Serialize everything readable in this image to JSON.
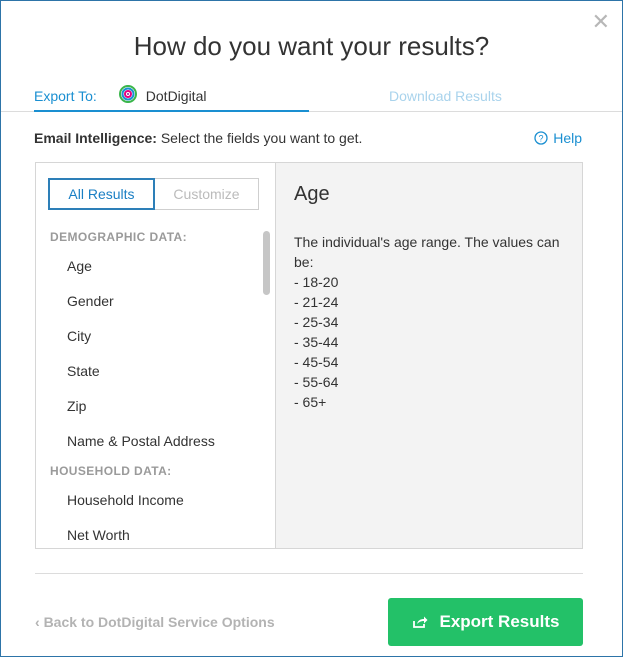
{
  "dialog": {
    "title": "How do you want your results?",
    "close_icon": "close-icon"
  },
  "tabs": {
    "export_label": "Export To:",
    "service_name": "DotDigital",
    "download_label": "Download Results"
  },
  "subheader": {
    "bold": "Email Intelligence:",
    "text": " Select the fields you want to get.",
    "help_label": "Help"
  },
  "segmented": {
    "all_results": "All Results",
    "customize": "Customize"
  },
  "fields": {
    "demographic_header": "DEMOGRAPHIC DATA:",
    "demographic_items": [
      "Age",
      "Gender",
      "City",
      "State",
      "Zip",
      "Name & Postal Address"
    ],
    "household_header": "HOUSEHOLD DATA:",
    "household_items": [
      "Household Income",
      "Net Worth"
    ]
  },
  "detail": {
    "title": "Age",
    "description": "The individual's age range. The values can be:",
    "values": [
      "- 18-20",
      "- 21-24",
      "- 25-34",
      "- 35-44",
      "- 45-54",
      "- 55-64",
      "- 65+"
    ]
  },
  "footer": {
    "back_label": "Back to DotDigital Service Options",
    "export_label": "Export Results"
  },
  "colors": {
    "accent": "#1a8fd1",
    "export_button": "#23c168"
  }
}
